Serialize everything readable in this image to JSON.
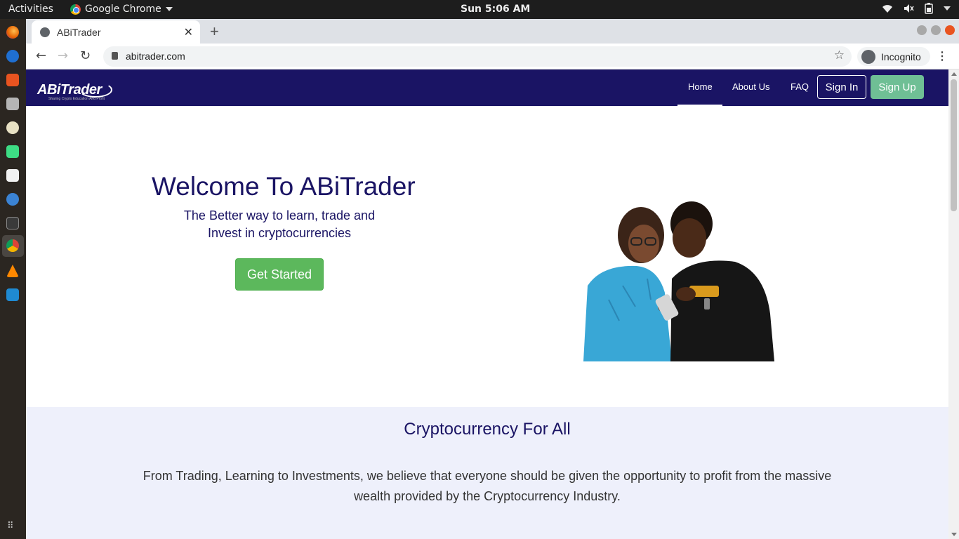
{
  "system_bar": {
    "activities_label": "Activities",
    "app_name": "Google Chrome",
    "clock": "Sun  5:06 AM"
  },
  "dock": {
    "items": [
      "firefox-icon",
      "thunderbird-icon",
      "software-center-icon",
      "files-icon",
      "rhythmbox-icon",
      "android-studio-icon",
      "document-viewer-icon",
      "help-icon",
      "terminal-icon",
      "chrome-icon",
      "vlc-icon",
      "vscode-icon"
    ],
    "show_apps_icon": "grid-icon"
  },
  "browser": {
    "tab_title": "ABiTrader",
    "url": "abitrader.com",
    "profile_label": "Incognito"
  },
  "site": {
    "logo_text": "ABiTrader",
    "logo_tagline": "Sharing Crypto Education And Profit",
    "nav": {
      "home": "Home",
      "about": "About Us",
      "faq": "FAQ",
      "sign_in": "Sign In",
      "sign_up": "Sign Up"
    },
    "hero": {
      "title": "Welcome To ABiTrader",
      "subtitle_line1": "The Better way to learn, trade and",
      "subtitle_line2": "Invest in cryptocurrencies",
      "cta": "Get Started"
    },
    "section": {
      "title": "Cryptocurrency For All",
      "body": "From Trading, Learning to Investments, we believe that everyone should be given the opportunity to profit from the massive wealth provided by the Cryptocurrency Industry."
    }
  },
  "colors": {
    "brand_navy": "#1a1464",
    "signup_green": "#6fbf95",
    "cta_green": "#5cb85c",
    "band_bg": "#eef0fb"
  }
}
